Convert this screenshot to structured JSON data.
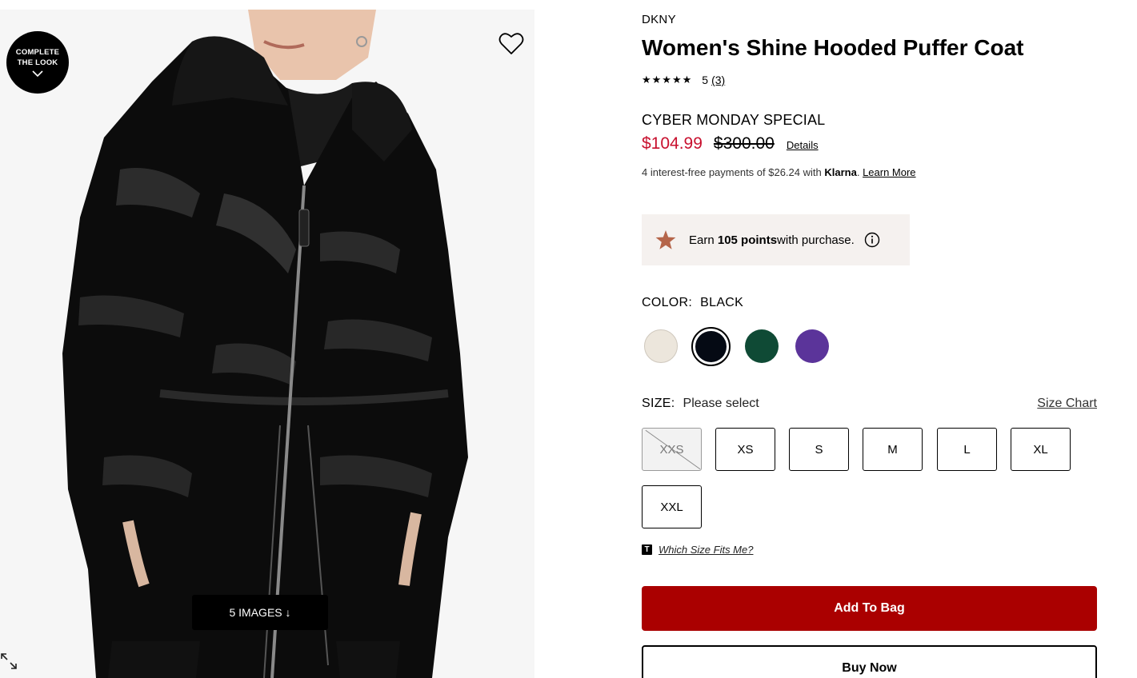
{
  "media": {
    "complete_look_line1": "COMPLETE",
    "complete_look_line2": "THE LOOK",
    "images_button": "5 IMAGES ↓",
    "icons": [
      "chevron-down-icon",
      "heart-icon",
      "expand-icon"
    ]
  },
  "product": {
    "brand": "DKNY",
    "title": "Women's Shine Hooded Puffer Coat",
    "stars": "★★★★★",
    "rating_value": "5",
    "rating_count": "(3)",
    "promo_label": "CYBER MONDAY SPECIAL",
    "sale_price": "$104.99",
    "original_price": "$300.00",
    "details_link": "Details",
    "klarna_prefix": "4 interest-free payments of $26.24 with ",
    "klarna_brand": "Klarna",
    "klarna_suffix": ". ",
    "klarna_learn_more": "Learn More",
    "points_prefix": "Earn ",
    "points_bold": "105 points",
    "points_suffix": " with purchase.",
    "color_label": "COLOR:",
    "color_value": "BLACK",
    "colors": [
      {
        "name": "cream",
        "hex": "#ece6dc"
      },
      {
        "name": "black",
        "hex": "#050a14",
        "selected": true
      },
      {
        "name": "green",
        "hex": "#0f4a35"
      },
      {
        "name": "purple",
        "hex": "#5b349a"
      }
    ],
    "size_label": "SIZE:",
    "size_value": "Please select",
    "size_chart": "Size Chart",
    "sizes": [
      {
        "label": "XXS",
        "available": false
      },
      {
        "label": "XS",
        "available": true
      },
      {
        "label": "S",
        "available": true
      },
      {
        "label": "M",
        "available": true
      },
      {
        "label": "L",
        "available": true
      },
      {
        "label": "XL",
        "available": true
      },
      {
        "label": "XXL",
        "available": true
      }
    ],
    "fit_icon": "T",
    "fit_link": "Which Size Fits Me?",
    "add_to_bag": "Add To Bag",
    "buy_now": "Buy Now"
  },
  "colors": {
    "sale_red": "#c8102e",
    "button_red": "#aa0000",
    "points_bg": "#f5f1ef",
    "star_bronze": "#b5654a"
  }
}
